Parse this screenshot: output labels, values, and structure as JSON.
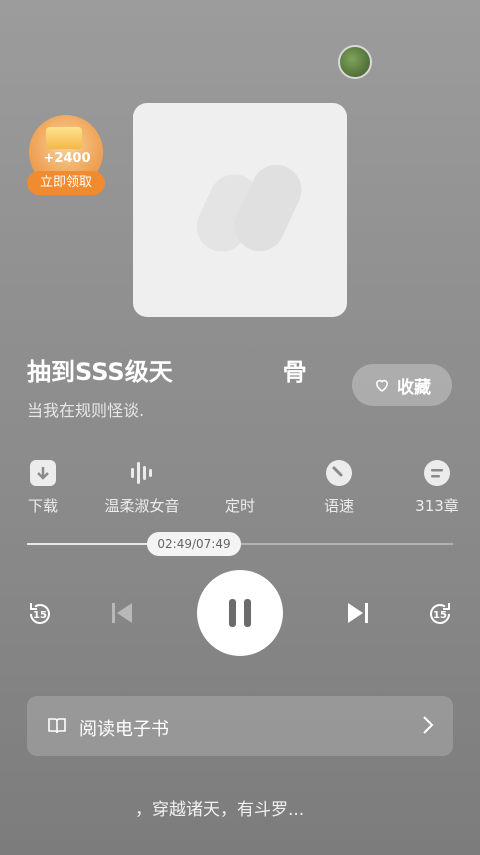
{
  "reward": {
    "amount": "+2400",
    "claim_label": "立即领取"
  },
  "book": {
    "title": "抽到SSS级天",
    "title_suffix": "骨",
    "subtitle": "当我在规则怪谈."
  },
  "favorite": {
    "label": "收藏",
    "icon": "heart-outline-icon"
  },
  "tools": [
    {
      "label": "下载",
      "icon": "download-icon"
    },
    {
      "label": "温柔淑女音",
      "icon": "voice-wave-icon"
    },
    {
      "label": "定时",
      "icon": "timer-icon"
    },
    {
      "label": "语速",
      "icon": "speed-icon"
    },
    {
      "label": "313章",
      "icon": "chapters-icon"
    }
  ],
  "progress": {
    "time": "02:49/07:49",
    "fraction": 0.36
  },
  "controls": {
    "rewind_seconds": "15",
    "forward_seconds": "15"
  },
  "read_ebook": {
    "label": "阅读电子书"
  },
  "bottom_text": "，穿越诸天，有斗罗..."
}
